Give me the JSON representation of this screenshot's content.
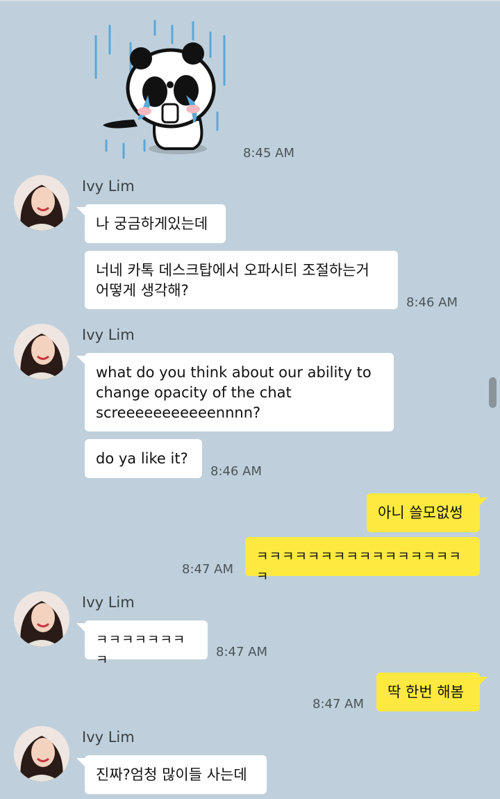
{
  "sender_name": "Ivy Lim",
  "sticker": {
    "name": "crying-panda-sticker",
    "time": "8:45 AM"
  },
  "groups": [
    {
      "messages": [
        "나 궁금하게있는데",
        "너네 카톡 데스크탑에서 오파시티 조절하는거\n어떻게 생각해?"
      ],
      "time": "8:46 AM"
    },
    {
      "messages": [
        "what do you think about our ability to\nchange opacity of the chat\nscreeeeeeeeeeennnn?",
        "do ya like it?"
      ],
      "time": "8:46 AM"
    },
    {
      "messages": [
        "ㅋㅋㅋㅋㅋㅋㅋㅋ"
      ],
      "time": "8:47 AM"
    },
    {
      "messages": [
        "진짜?엄청 많이들 사는데"
      ],
      "time": ""
    }
  ],
  "outgoing": [
    {
      "messages": [
        "아니 쓸모없썽",
        "ㅋㅋㅋㅋㅋㅋㅋㅋㅋㅋㅋㅋㅋㅋㅋㅋㅋ"
      ],
      "time": "8:47 AM"
    },
    {
      "messages": [
        "딱 한번 해봄"
      ],
      "time": "8:47 AM"
    }
  ],
  "colors": {
    "background": "#bfd0dc",
    "incoming_bubble": "#ffffff",
    "outgoing_bubble": "#fde940"
  }
}
